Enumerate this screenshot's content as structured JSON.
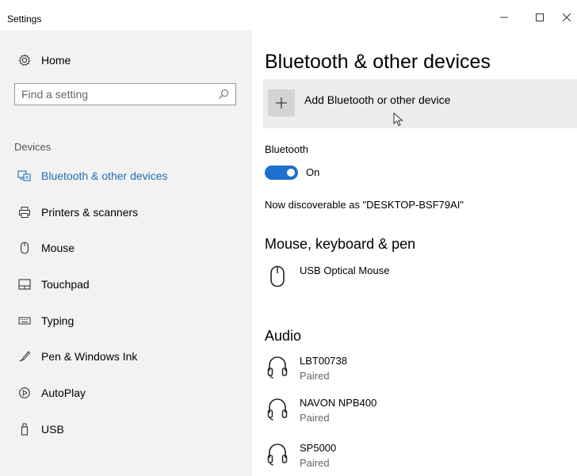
{
  "window": {
    "title": "Settings",
    "controls": {
      "minimize": "–",
      "maximize": "☐",
      "close": "✕"
    }
  },
  "sidebar": {
    "home_label": "Home",
    "search": {
      "placeholder": "Find a setting",
      "value": ""
    },
    "group_label": "Devices",
    "items": [
      {
        "label": "Bluetooth & other devices",
        "icon": "bluetooth-devices-icon",
        "selected": true
      },
      {
        "label": "Printers & scanners",
        "icon": "printer-icon",
        "selected": false
      },
      {
        "label": "Mouse",
        "icon": "mouse-icon",
        "selected": false
      },
      {
        "label": "Touchpad",
        "icon": "touchpad-icon",
        "selected": false
      },
      {
        "label": "Typing",
        "icon": "keyboard-icon",
        "selected": false
      },
      {
        "label": "Pen & Windows Ink",
        "icon": "pen-icon",
        "selected": false
      },
      {
        "label": "AutoPlay",
        "icon": "autoplay-icon",
        "selected": false
      },
      {
        "label": "USB",
        "icon": "usb-icon",
        "selected": false
      }
    ]
  },
  "main": {
    "title": "Bluetooth & other devices",
    "add_device_label": "Add Bluetooth or other device",
    "bluetooth": {
      "label": "Bluetooth",
      "state": "On",
      "enabled": true
    },
    "discoverable_text": "Now discoverable as \"DESKTOP-BSF79AI\"",
    "mouse_section": {
      "heading": "Mouse, keyboard & pen",
      "devices": [
        {
          "name": "USB Optical Mouse",
          "icon": "mouse-icon"
        }
      ]
    },
    "audio_section": {
      "heading": "Audio",
      "devices": [
        {
          "name": "LBT00738",
          "status": "Paired",
          "icon": "headphones-icon"
        },
        {
          "name": "NAVON NPB400",
          "status": "Paired",
          "icon": "headphones-icon"
        },
        {
          "name": "SP5000",
          "status": "Paired",
          "icon": "headphones-icon"
        }
      ]
    }
  },
  "colors": {
    "accent": "#1f6fd0",
    "selected_text": "#1f6fb5",
    "sidebar_bg": "#f2f2f2"
  }
}
